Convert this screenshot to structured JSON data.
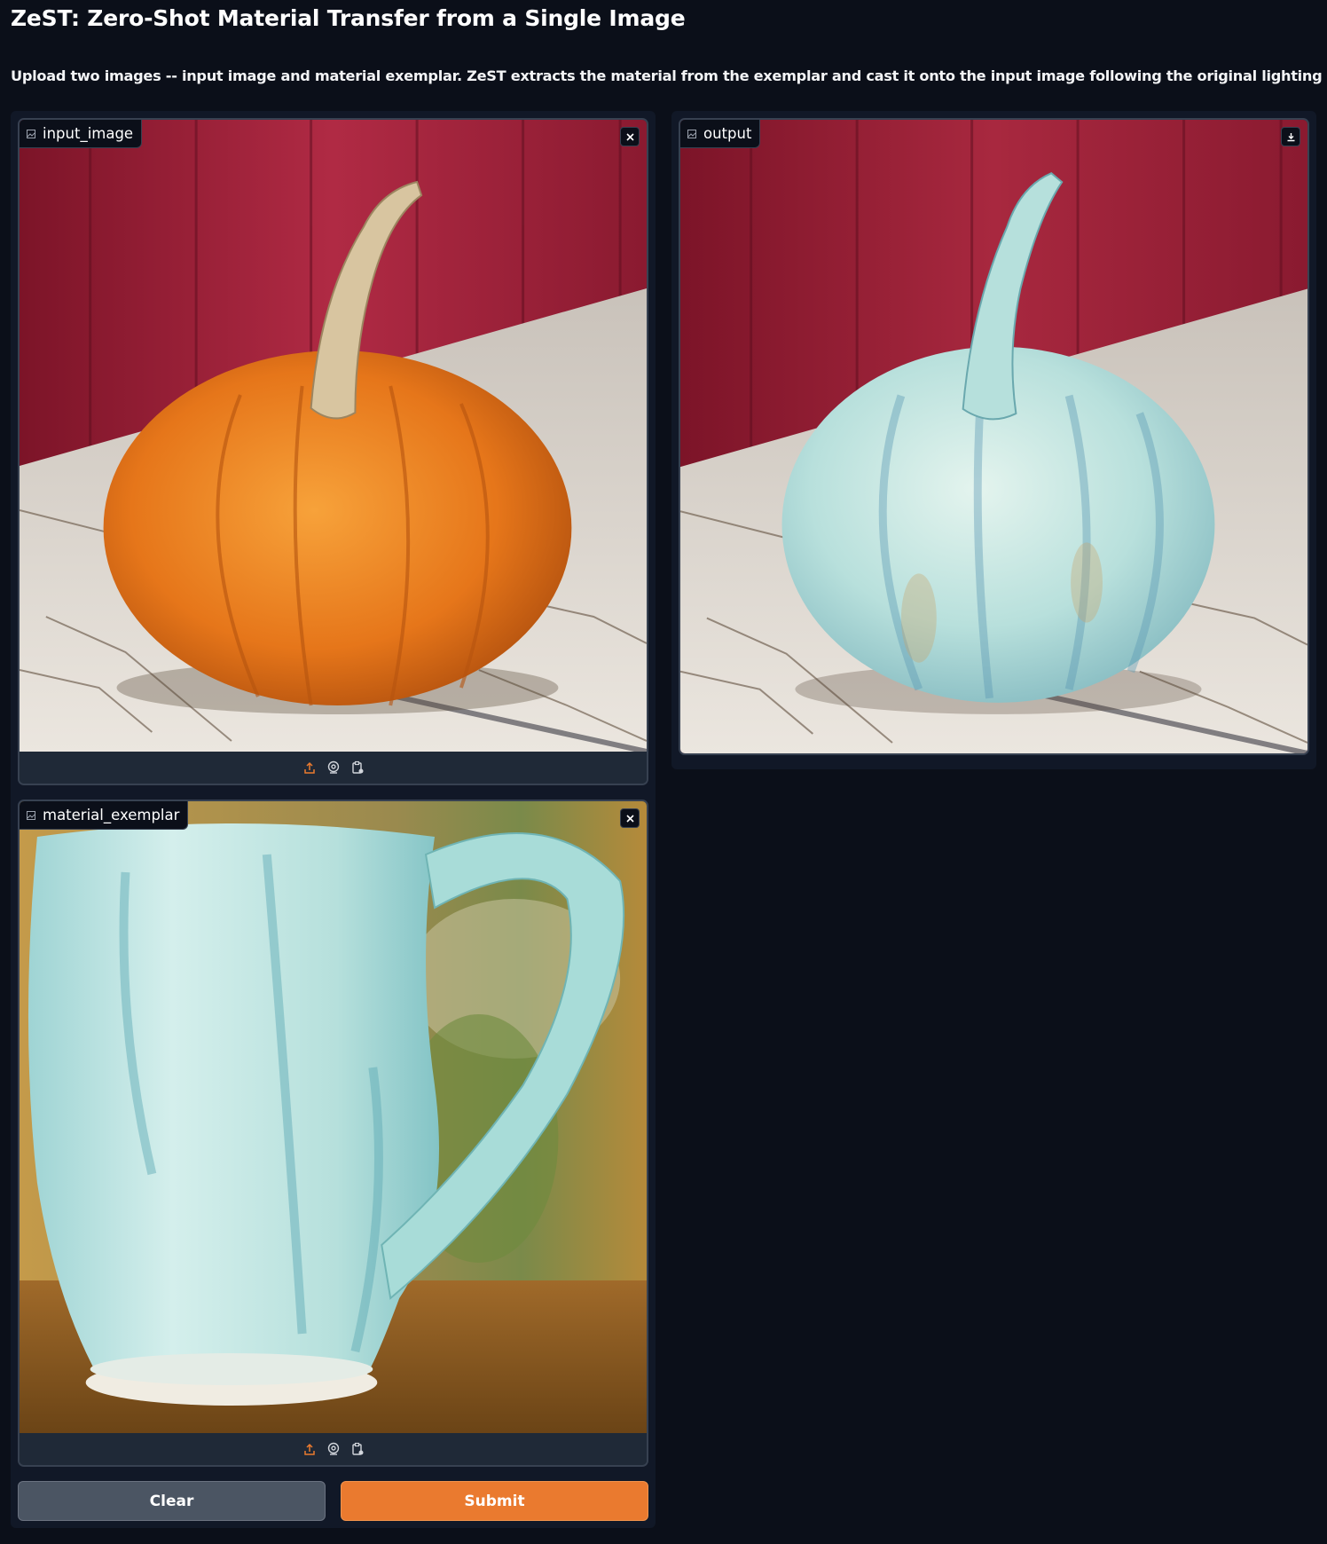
{
  "header": {
    "title": "ZeST: Zero-Shot Material Transfer from a Single Image",
    "description": "Upload two images -- input image and material exemplar. ZeST extracts the material from the exemplar and cast it onto the input image following the original lighting cues."
  },
  "panels": {
    "input_image": {
      "label": "input_image",
      "content": "photo-orange-pumpkin",
      "tools": [
        "upload-icon",
        "webcam-icon",
        "clipboard-icon"
      ],
      "corner": "close-icon"
    },
    "material_exemplar": {
      "label": "material_exemplar",
      "content": "photo-turquoise-ceramic-mug",
      "tools": [
        "upload-icon",
        "webcam-icon",
        "clipboard-icon"
      ],
      "corner": "close-icon"
    },
    "output": {
      "label": "output",
      "content": "photo-turquoise-ceramic-pumpkin",
      "corner": "download-icon"
    }
  },
  "buttons": {
    "clear": "Clear",
    "submit": "Submit"
  },
  "colors": {
    "background": "#0b0f19",
    "panel": "#1f2937",
    "border": "#374151",
    "accent": "#ea7a2f",
    "secondary_button": "#4b5563"
  }
}
